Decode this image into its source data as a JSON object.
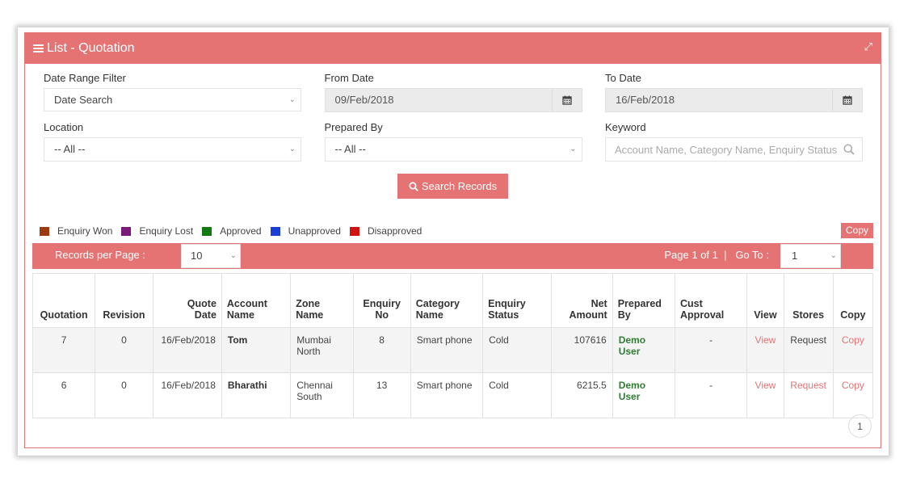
{
  "panel": {
    "title": "List - Quotation"
  },
  "filters": {
    "date_range": {
      "label": "Date Range Filter",
      "value": "Date Search"
    },
    "from_date": {
      "label": "From Date",
      "value": "09/Feb/2018"
    },
    "to_date": {
      "label": "To Date",
      "value": "16/Feb/2018"
    },
    "location": {
      "label": "Location",
      "value": "-- All --"
    },
    "prepared_by": {
      "label": "Prepared By",
      "value": "-- All --"
    },
    "keyword": {
      "label": "Keyword",
      "placeholder": "Account Name, Category Name, Enquiry Status"
    }
  },
  "search_button": "Search Records",
  "legend": [
    {
      "label": "Enquiry Won",
      "color": "#9e3a0f"
    },
    {
      "label": "Enquiry Lost",
      "color": "#7b1a7b"
    },
    {
      "label": "Approved",
      "color": "#127a12"
    },
    {
      "label": "Unapproved",
      "color": "#1a3fd6"
    },
    {
      "label": "Disapproved",
      "color": "#d11212"
    }
  ],
  "copy_button": "Copy",
  "pager": {
    "records_label": "Records per Page :",
    "records_value": "10",
    "page_info": "Page 1 of 1  |   Go To :",
    "goto_value": "1"
  },
  "table": {
    "headers": [
      [
        "Quotation"
      ],
      [
        "Revision"
      ],
      [
        "Quote",
        "Date"
      ],
      [
        "Account",
        "Name"
      ],
      [
        "Zone",
        "Name"
      ],
      [
        "Enquiry",
        "No"
      ],
      [
        "Category",
        "Name"
      ],
      [
        "Enquiry",
        "Status"
      ],
      [
        "Net",
        "Amount"
      ],
      [
        "Prepared",
        "By"
      ],
      [
        "Cust",
        "Approval"
      ],
      [
        "View"
      ],
      [
        "Stores"
      ],
      [
        "Copy"
      ]
    ],
    "rows": [
      {
        "quotation": "7",
        "revision": "0",
        "date": "16/Feb/2018",
        "account": "Tom",
        "zone": [
          "Mumbai",
          "North"
        ],
        "enquiry_no": "8",
        "category": "Smart phone",
        "status": "Cold",
        "amount": "107616",
        "prepared": [
          "Demo",
          "User"
        ],
        "approval": "-",
        "view": "View",
        "stores": "Request",
        "copy": "Copy"
      },
      {
        "quotation": "6",
        "revision": "0",
        "date": "16/Feb/2018",
        "account": "Bharathi",
        "zone": [
          "Chennai",
          "South"
        ],
        "enquiry_no": "13",
        "category": "Smart phone",
        "status": "Cold",
        "amount": "6215.5",
        "prepared": [
          "Demo",
          "User"
        ],
        "approval": "-",
        "view": "View",
        "stores": "Request",
        "copy": "Copy"
      }
    ]
  },
  "pagination": {
    "current": "1"
  }
}
